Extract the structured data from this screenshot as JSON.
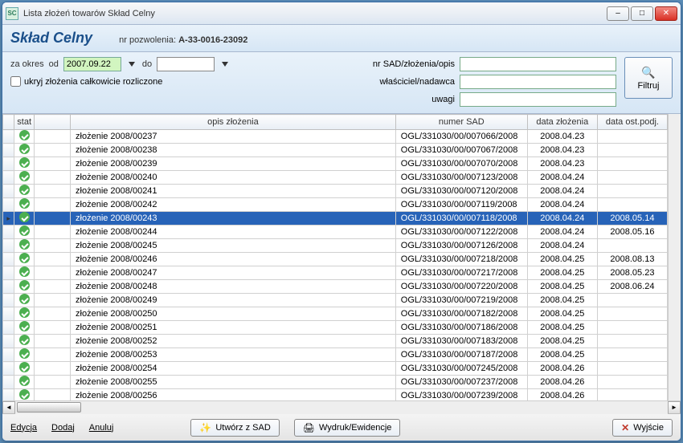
{
  "window": {
    "app_icon_text": "SC",
    "title": "Lista złożeń towarów Skład Celny"
  },
  "header": {
    "brand": "Skład Celny",
    "permit_label": "nr pozwolenia:",
    "permit_value": "A-33-0016-23092"
  },
  "filter": {
    "period_label": "za okres",
    "from_label": "od",
    "from_value": "2007.09.22",
    "to_label": "do",
    "to_value": "",
    "hide_settled_label": "ukryj złożenia całkowicie rozliczone",
    "sad_label": "nr SAD/złożenia/opis",
    "sad_value": "",
    "owner_label": "właściciel/nadawca",
    "owner_value": "",
    "remarks_label": "uwagi",
    "remarks_value": "",
    "filter_btn": "Filtruj"
  },
  "columns": {
    "stat": "stat",
    "blank": "",
    "opis": "opis złożenia",
    "sad": "numer SAD",
    "data_z": "data złożenia",
    "data_p": "data ost.podj."
  },
  "rows": [
    {
      "opis": "złożenie 2008/00237",
      "sad": "OGL/331030/00/007066/2008",
      "dz": "2008.04.23",
      "dp": ""
    },
    {
      "opis": "złożenie 2008/00238",
      "sad": "OGL/331030/00/007067/2008",
      "dz": "2008.04.23",
      "dp": ""
    },
    {
      "opis": "złożenie 2008/00239",
      "sad": "OGL/331030/00/007070/2008",
      "dz": "2008.04.23",
      "dp": ""
    },
    {
      "opis": "złożenie 2008/00240",
      "sad": "OGL/331030/00/007123/2008",
      "dz": "2008.04.24",
      "dp": ""
    },
    {
      "opis": "złożenie 2008/00241",
      "sad": "OGL/331030/00/007120/2008",
      "dz": "2008.04.24",
      "dp": ""
    },
    {
      "opis": "złożenie 2008/00242",
      "sad": "OGL/331030/00/007119/2008",
      "dz": "2008.04.24",
      "dp": ""
    },
    {
      "opis": "złożenie 2008/00243",
      "sad": "OGL/331030/00/007118/2008",
      "dz": "2008.04.24",
      "dp": "2008.05.14",
      "selected": true
    },
    {
      "opis": "złożenie 2008/00244",
      "sad": "OGL/331030/00/007122/2008",
      "dz": "2008.04.24",
      "dp": "2008.05.16"
    },
    {
      "opis": "złożenie 2008/00245",
      "sad": "OGL/331030/00/007126/2008",
      "dz": "2008.04.24",
      "dp": ""
    },
    {
      "opis": "złożenie 2008/00246",
      "sad": "OGL/331030/00/007218/2008",
      "dz": "2008.04.25",
      "dp": "2008.08.13"
    },
    {
      "opis": "złożenie 2008/00247",
      "sad": "OGL/331030/00/007217/2008",
      "dz": "2008.04.25",
      "dp": "2008.05.23"
    },
    {
      "opis": "złożenie 2008/00248",
      "sad": "OGL/331030/00/007220/2008",
      "dz": "2008.04.25",
      "dp": "2008.06.24"
    },
    {
      "opis": "złożenie 2008/00249",
      "sad": "OGL/331030/00/007219/2008",
      "dz": "2008.04.25",
      "dp": ""
    },
    {
      "opis": "złożenie 2008/00250",
      "sad": "OGL/331030/00/007182/2008",
      "dz": "2008.04.25",
      "dp": ""
    },
    {
      "opis": "złożenie 2008/00251",
      "sad": "OGL/331030/00/007186/2008",
      "dz": "2008.04.25",
      "dp": ""
    },
    {
      "opis": "złożenie 2008/00252",
      "sad": "OGL/331030/00/007183/2008",
      "dz": "2008.04.25",
      "dp": ""
    },
    {
      "opis": "złożenie 2008/00253",
      "sad": "OGL/331030/00/007187/2008",
      "dz": "2008.04.25",
      "dp": ""
    },
    {
      "opis": "złożenie 2008/00254",
      "sad": "OGL/331030/00/007245/2008",
      "dz": "2008.04.26",
      "dp": ""
    },
    {
      "opis": "złożenie 2008/00255",
      "sad": "OGL/331030/00/007237/2008",
      "dz": "2008.04.26",
      "dp": ""
    },
    {
      "opis": "złożenie 2008/00256",
      "sad": "OGL/331030/00/007239/2008",
      "dz": "2008.04.26",
      "dp": ""
    }
  ],
  "footer": {
    "edit": "Edycja",
    "add": "Dodaj",
    "cancel": "Anuluj",
    "create_sad": "Utwórz z SAD",
    "print": "Wydruk/Ewidencje",
    "exit": "Wyjście"
  }
}
